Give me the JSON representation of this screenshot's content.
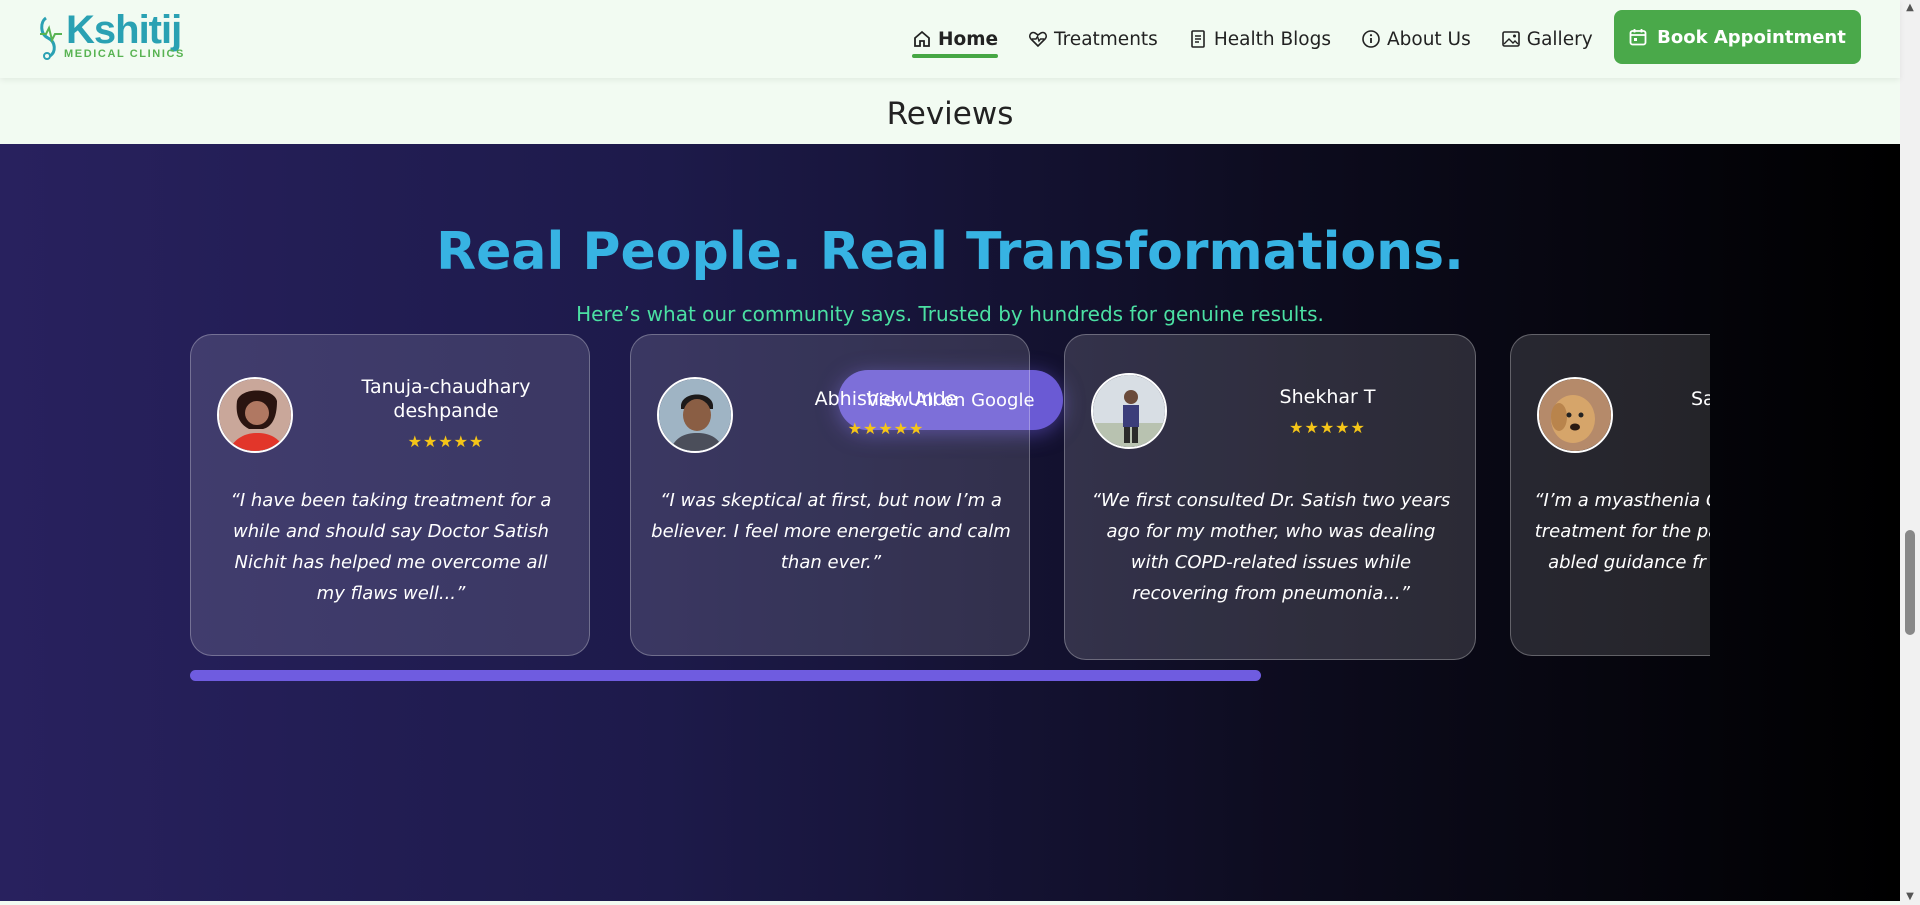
{
  "header": {
    "logo_text": "Kshitij",
    "logo_subtext": "MEDICAL CLINICS",
    "nav": [
      {
        "label": "Home",
        "icon": "home-icon"
      },
      {
        "label": "Treatments",
        "icon": "heart-pulse-icon"
      },
      {
        "label": "Health Blogs",
        "icon": "document-icon"
      },
      {
        "label": "About Us",
        "icon": "info-icon"
      },
      {
        "label": "Gallery",
        "icon": "gallery-icon"
      }
    ],
    "book_label": "Book Appointment"
  },
  "section_heading": "Reviews",
  "hero": {
    "title": "Real People. Real Transformations.",
    "subtitle": "Here’s what our community says. Trusted by hundreds for genuine results.",
    "cta_label": "View All on Google"
  },
  "reviews": [
    {
      "name": "Tanuja-chaudhary deshpande",
      "stars": "★★★★★",
      "quote": "“I have been taking treatment for a while and should say Doctor Satish Nichit has helped me overcome all my flaws well...”"
    },
    {
      "name": "Abhishek Unde",
      "stars": "★★★★★",
      "quote": "“I was skeptical at first, but now I’m a believer. I feel more energetic and calm than ever.”"
    },
    {
      "name": "Shekhar T",
      "stars": "★★★★★",
      "quote": "“We first consulted Dr. Satish two years ago for my mother, who was dealing with COPD-related issues while recovering from pneumonia...”"
    },
    {
      "name": "Sa",
      "stars": "",
      "quote": "“I’m a myasthenia G treatment for the pa abled guidance fr"
    }
  ],
  "carousel_progress": 0.705,
  "colors": {
    "brand_green": "#4aa94a",
    "brand_teal": "#2aa1b3",
    "accent_purple": "#6a5ad4",
    "title_blue": "#37b3e3",
    "subtitle_green": "#4be0a3",
    "star_gold": "#f5c518"
  }
}
